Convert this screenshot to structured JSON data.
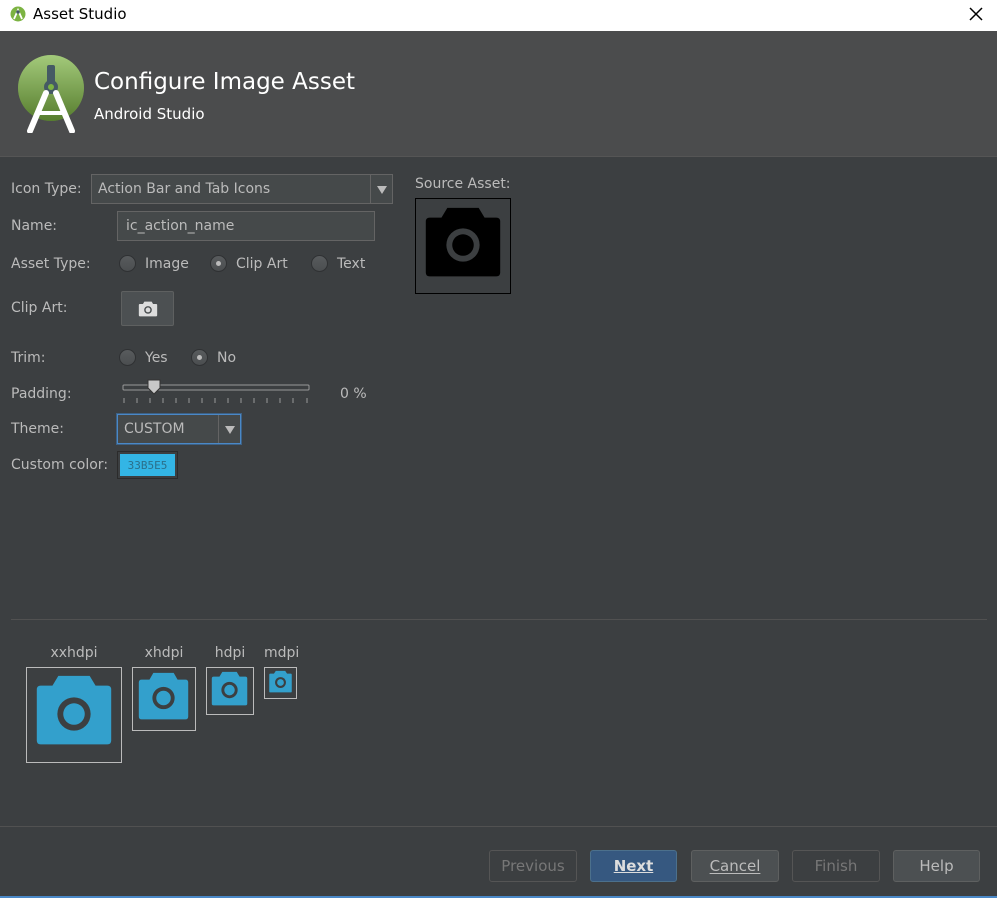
{
  "window": {
    "title": "Asset Studio"
  },
  "header": {
    "title": "Configure Image Asset",
    "subtitle": "Android Studio"
  },
  "form": {
    "icon_type": {
      "label": "Icon Type:",
      "value": "Action Bar and Tab Icons"
    },
    "name": {
      "label": "Name:",
      "value": "ic_action_name"
    },
    "asset_type": {
      "label": "Asset Type:",
      "options": [
        "Image",
        "Clip Art",
        "Text"
      ],
      "selected": "Clip Art"
    },
    "clip_art": {
      "label": "Clip Art:",
      "icon": "camera-icon"
    },
    "trim": {
      "label": "Trim:",
      "options": [
        "Yes",
        "No"
      ],
      "selected": "No"
    },
    "padding": {
      "label": "Padding:",
      "value": "0 %",
      "level_percent": 0
    },
    "theme": {
      "label": "Theme:",
      "value": "CUSTOM"
    },
    "custom_color": {
      "label": "Custom color:",
      "value": "33B5E5",
      "hex": "#33b5e5"
    }
  },
  "source": {
    "label": "Source Asset:"
  },
  "densities": [
    "xxhdpi",
    "xhdpi",
    "hdpi",
    "mdpi"
  ],
  "buttons": {
    "previous": "Previous",
    "next": "Next",
    "cancel": "Cancel",
    "finish": "Finish",
    "help": "Help"
  },
  "colors": {
    "accent": "#33b5e5",
    "background": "#3c3f41",
    "header": "#4b4c4d",
    "primary_button": "#365880"
  }
}
